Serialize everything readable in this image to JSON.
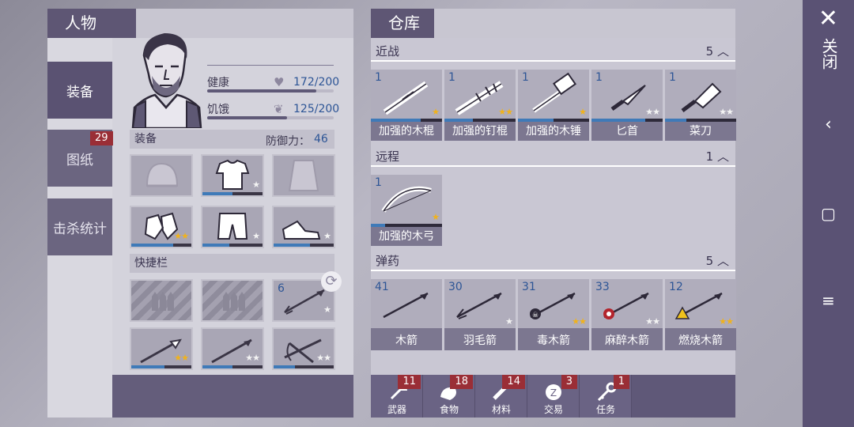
{
  "character": {
    "title": "人物",
    "health_label": "健康",
    "health_value": "172/200",
    "health_fraction": 0.86,
    "hunger_label": "饥饿",
    "hunger_value": "125/200",
    "hunger_fraction": 0.63,
    "equipment_label": "装备",
    "defense_label": "防御力：",
    "defense_value": "46",
    "hotbar_label": "快捷栏",
    "hotbar_arrow_count": "6"
  },
  "nav": {
    "equipment": "装备",
    "blueprints": "图纸",
    "blueprints_badge": "29",
    "kill_stats": "击杀统计"
  },
  "storage": {
    "title": "仓库",
    "melee_label": "近战",
    "melee_count": "5",
    "ranged_label": "远程",
    "ranged_count": "1",
    "ammo_label": "弹药",
    "ammo_count": "5",
    "melee_items": [
      {
        "count": "1",
        "name": "加强的木棍",
        "stars": 1,
        "star_color": "gold",
        "durability": 0.7
      },
      {
        "count": "1",
        "name": "加强的钉棍",
        "stars": 2,
        "star_color": "gold",
        "durability": 0.4
      },
      {
        "count": "1",
        "name": "加强的木锤",
        "stars": 1,
        "star_color": "gold",
        "durability": 0.5
      },
      {
        "count": "1",
        "name": "匕首",
        "stars": 2,
        "star_color": "white",
        "durability": 0.75
      },
      {
        "count": "1",
        "name": "菜刀",
        "stars": 2,
        "star_color": "white",
        "durability": 0.3
      }
    ],
    "ranged_items": [
      {
        "count": "1",
        "name": "加强的木弓",
        "stars": 1,
        "star_color": "gold",
        "durability": 0.2
      }
    ],
    "ammo_items": [
      {
        "count": "41",
        "name": "木箭",
        "stars": 0,
        "star_color": "none"
      },
      {
        "count": "30",
        "name": "羽毛箭",
        "stars": 1,
        "star_color": "white"
      },
      {
        "count": "31",
        "name": "毒木箭",
        "stars": 2,
        "star_color": "gold"
      },
      {
        "count": "33",
        "name": "麻醉木箭",
        "stars": 2,
        "star_color": "white"
      },
      {
        "count": "12",
        "name": "燃烧木箭",
        "stars": 2,
        "star_color": "gold"
      }
    ]
  },
  "bottom_tabs": [
    {
      "label": "武器",
      "badge": "11"
    },
    {
      "label": "食物",
      "badge": "18"
    },
    {
      "label": "材料",
      "badge": "14"
    },
    {
      "label": "交易",
      "badge": "3"
    },
    {
      "label": "任务",
      "badge": "1"
    }
  ],
  "right_bar": {
    "close_label": "关闭",
    "close_icon": "close-icon",
    "back_icon": "chevron-left-icon",
    "home_icon": "square-icon",
    "menu_icon": "menu-icon"
  },
  "colors": {
    "header": "#5e5674",
    "durability": "#3f7ab8",
    "badge": "#9a2e36",
    "star_gold": "#f0b21c"
  }
}
